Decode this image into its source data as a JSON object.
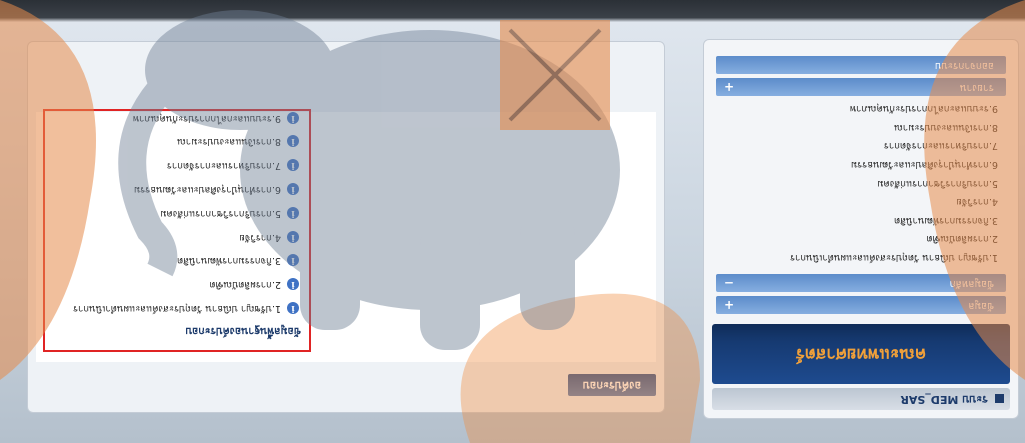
{
  "header": {
    "title": "ระบบ MED_SAR",
    "icon": "grid-icon"
  },
  "banner": {
    "title": "คณะแพทยศาสตร์",
    "color": "#f0a03a"
  },
  "sidebar": {
    "sections": [
      {
        "label": "ข้อมูล",
        "toggle": "+"
      },
      {
        "label": "ข้อมูลหลัก",
        "toggle": "−"
      },
      {
        "label": "รายงาน",
        "toggle": "+"
      },
      {
        "label": "ออกจากระบบ",
        "toggle": ""
      }
    ],
    "menu_items": [
      "1.ปรัชญา ปณิธาน วัตถุประสงค์และแผนดำเนินการ",
      "2.การผลิตบัณฑิต",
      "3.กิจกรรมการพัฒนานิสิต",
      "4.การวิจัย",
      "5.การบริการวิชาการแก่สังคม",
      "6.การทำนุบำรุงศิลปะและวัฒนธรรม",
      "7.การบริหารและการจัดการ",
      "8.การเงินและงบประมาณ",
      "9.ระบบและกลไกการประกันคุณภาพ"
    ]
  },
  "main": {
    "tab_label": "องค์ประกอบ",
    "box_title": "ข้อมูลพื้นฐานองค์ประกอบ",
    "items": [
      "1.ปรัชญา ปณิธาน วัตถุประสงค์และแผนดำเนินการ",
      "2.การผลิตบัณฑิต",
      "3.กิจกรรมการพัฒนานิสิต",
      "4.การวิจัย",
      "5.การบริการวิชาการแก่สังคม",
      "6.การทำนุบำรุงศิลปะและวัฒนธรรม",
      "7.การบริหารและการจัดการ",
      "8.การเงินและงบประมาณ",
      "9.ระบบและกลไกการประกันคุณภาพ"
    ],
    "item_icon": "info-icon"
  },
  "colors": {
    "accent": "#1d3b6b",
    "highlight": "#e02424",
    "accordion": "#6b98d2"
  }
}
